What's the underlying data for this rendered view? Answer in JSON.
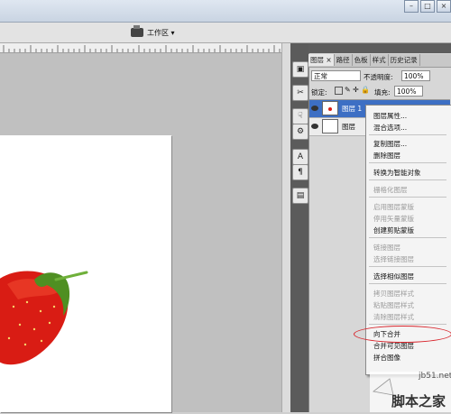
{
  "options_bar": {
    "workspace_label": "工作区 ▾"
  },
  "tools": [
    "▣",
    "✂",
    "☟",
    "⚙",
    "A",
    "¶",
    "▤"
  ],
  "layers_panel": {
    "tabs": [
      "图层 ×",
      "路径",
      "色板",
      "样式",
      "历史记录"
    ],
    "blend_mode": "正常",
    "opacity_label": "不透明度:",
    "opacity_value": "100%",
    "lock_label": "锁定:",
    "fill_label": "填充:",
    "fill_value": "100%",
    "layers": [
      {
        "name": "图层 1"
      },
      {
        "name": "图层"
      }
    ]
  },
  "context_menu": {
    "items": [
      {
        "label": "图层属性...",
        "disabled": false
      },
      {
        "label": "混合选项...",
        "disabled": false
      },
      {
        "label": "复制图层...",
        "disabled": false
      },
      {
        "label": "删除图层",
        "disabled": false
      },
      {
        "label": "转换为智能对象",
        "disabled": false
      },
      {
        "label": "栅格化图层",
        "disabled": true
      },
      {
        "label": "启用图层蒙版",
        "disabled": true
      },
      {
        "label": "停用矢量蒙版",
        "disabled": true
      },
      {
        "label": "创建剪贴蒙版",
        "disabled": false
      },
      {
        "label": "链接图层",
        "disabled": true
      },
      {
        "label": "选择链接图层",
        "disabled": true
      },
      {
        "label": "选择相似图层",
        "disabled": false
      },
      {
        "label": "拷贝图层样式",
        "disabled": true
      },
      {
        "label": "粘贴图层样式",
        "disabled": true
      },
      {
        "label": "清除图层样式",
        "disabled": true
      },
      {
        "label": "向下合并",
        "disabled": false
      },
      {
        "label": "合并可见图层",
        "disabled": false
      },
      {
        "label": "拼合图像",
        "disabled": false
      }
    ]
  },
  "watermark": {
    "site": "jb51.net",
    "brand": "脚本之家"
  },
  "colors": {
    "highlight": "#d8232a",
    "strawberry": "#e2231a",
    "leaf": "#5f9f2a"
  }
}
